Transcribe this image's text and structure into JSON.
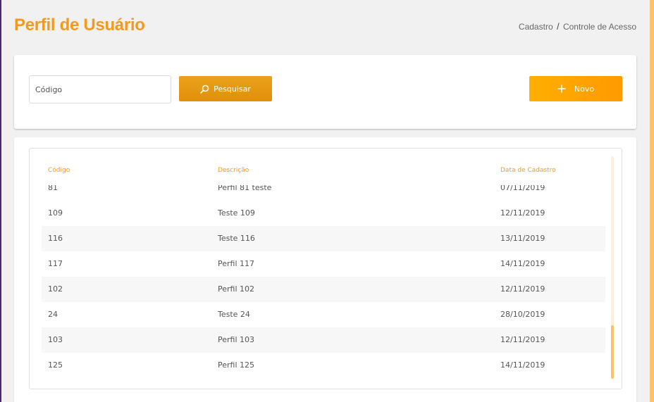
{
  "header": {
    "title": "Perfil de Usuário",
    "breadcrumb": {
      "parent": "Cadastro",
      "separator": "/",
      "current": "Controle de Acesso"
    }
  },
  "search": {
    "placeholder": "Código",
    "value": "",
    "search_label": "Pesquisar",
    "search_icon": "search-icon",
    "new_label": "Novo",
    "new_icon": "plus-icon"
  },
  "table": {
    "columns": [
      "Código",
      "Descrição",
      "Data de Cadastro"
    ],
    "rows": [
      {
        "codigo": "81",
        "descricao": "Perfil 81 teste",
        "data": "07/11/2019"
      },
      {
        "codigo": "109",
        "descricao": "Teste 109",
        "data": "12/11/2019"
      },
      {
        "codigo": "116",
        "descricao": "Teste 116",
        "data": "13/11/2019"
      },
      {
        "codigo": "117",
        "descricao": "Perfil 117",
        "data": "14/11/2019"
      },
      {
        "codigo": "102",
        "descricao": "Perfil 102",
        "data": "12/11/2019"
      },
      {
        "codigo": "24",
        "descricao": "Teste 24",
        "data": "28/10/2019"
      },
      {
        "codigo": "103",
        "descricao": "Perfil 103",
        "data": "12/11/2019"
      },
      {
        "codigo": "125",
        "descricao": "Perfil 125",
        "data": "14/11/2019"
      }
    ]
  },
  "colors": {
    "accent": "#f39a1e",
    "button_search": "#e4970f",
    "button_new": "#ffa500",
    "scrollbar": "#fbc26a"
  }
}
